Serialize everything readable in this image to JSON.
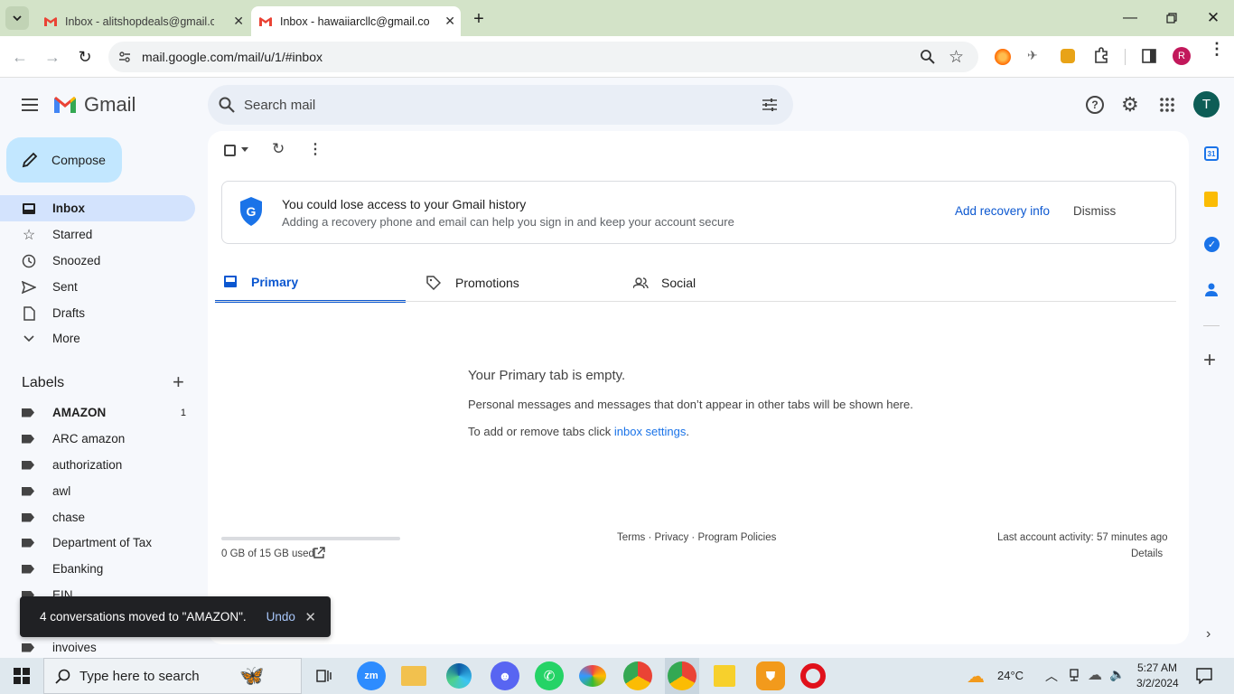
{
  "browser": {
    "tabs": [
      {
        "title": "Inbox - alitshopdeals@gmail.com",
        "active": false
      },
      {
        "title": "Inbox - hawaiiarcllc@gmail.com",
        "active": true
      }
    ],
    "url": "mail.google.com/mail/u/1/#inbox",
    "profile_initial": "R"
  },
  "gmail": {
    "logo_text": "Gmail",
    "search_placeholder": "Search mail",
    "account_initial": "T",
    "compose_label": "Compose",
    "nav": [
      {
        "label": "Inbox",
        "icon": "inbox-icon",
        "active": true
      },
      {
        "label": "Starred",
        "icon": "star-icon"
      },
      {
        "label": "Snoozed",
        "icon": "clock-icon"
      },
      {
        "label": "Sent",
        "icon": "send-icon"
      },
      {
        "label": "Drafts",
        "icon": "draft-icon"
      },
      {
        "label": "More",
        "icon": "chevron-down-icon"
      }
    ],
    "labels_heading": "Labels",
    "labels": [
      {
        "name": "AMAZON",
        "count": "1",
        "bold": true
      },
      {
        "name": "ARC amazon"
      },
      {
        "name": "authorization"
      },
      {
        "name": "awl"
      },
      {
        "name": "chase"
      },
      {
        "name": "Department of Tax"
      },
      {
        "name": "Ebanking"
      },
      {
        "name": "EIN"
      },
      {
        "name": "invoives"
      }
    ],
    "banner": {
      "title": "You could lose access to your Gmail history",
      "subtitle": "Adding a recovery phone and email can help you sign in and keep your account secure",
      "action": "Add recovery info",
      "dismiss": "Dismiss"
    },
    "category_tabs": [
      {
        "label": "Primary",
        "icon": "inbox-icon",
        "active": true
      },
      {
        "label": "Promotions",
        "icon": "tag-icon"
      },
      {
        "label": "Social",
        "icon": "people-icon"
      }
    ],
    "empty": {
      "title": "Your Primary tab is empty.",
      "line1": "Personal messages and messages that don’t appear in other tabs will be shown here.",
      "line2_prefix": "To add or remove tabs click ",
      "line2_link": "inbox settings",
      "line2_suffix": "."
    },
    "footer": {
      "storage": "0 GB of 15 GB used",
      "storage_fraction": 0.0,
      "links": "Terms · Privacy · Program Policies",
      "activity": "Last account activity: 57 minutes ago",
      "details": "Details"
    },
    "toast": {
      "message": "4 conversations moved to \"AMAZON\".",
      "undo": "Undo"
    }
  },
  "taskbar": {
    "search_placeholder": "Type here to search",
    "weather": "24°C",
    "time": "5:27 AM",
    "date": "3/2/2024",
    "zoom_label": "zm"
  },
  "colors": {
    "gmail_blue": "#0b57d0",
    "link_blue": "#1a73e8",
    "compose_bg": "#c2e7ff",
    "active_nav": "#d3e3fd",
    "tabstrip": "#d3e3c8"
  }
}
